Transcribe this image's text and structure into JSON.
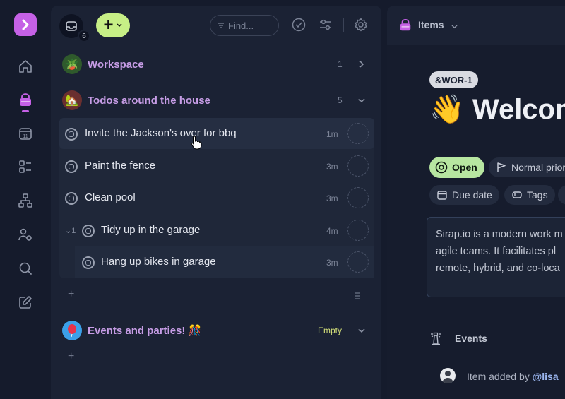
{
  "app": {
    "logo_icon": "chevron-right-icon",
    "accent": "#c561e6"
  },
  "rail": {
    "items": [
      {
        "name": "home",
        "icon": "home-icon"
      },
      {
        "name": "items",
        "icon": "basket-icon",
        "active": true
      },
      {
        "name": "calendar",
        "icon": "calendar-icon",
        "badge": "11"
      },
      {
        "name": "boards",
        "icon": "board-icon"
      },
      {
        "name": "hierarchy",
        "icon": "hierarchy-icon"
      },
      {
        "name": "team-settings",
        "icon": "users-gear-icon"
      },
      {
        "name": "search",
        "icon": "search-icon"
      },
      {
        "name": "compose",
        "icon": "compose-icon"
      }
    ]
  },
  "toolbar": {
    "inbox_count": "6",
    "add_symbol": "+",
    "search_placeholder": "Find...",
    "icons": [
      "check-circle-icon",
      "filter-sliders-icon",
      "gear-icon"
    ]
  },
  "groups": [
    {
      "title": "Workspace",
      "count": "1",
      "avatar": "🪴",
      "expanded": false
    },
    {
      "title": "Todos around the house",
      "count": "5",
      "avatar": "🏡",
      "expanded": true
    },
    {
      "title": "Events and parties! 🎊",
      "status": "Empty",
      "avatar": "🎈",
      "expanded": true
    }
  ],
  "tasks": [
    {
      "title": "Invite the Jackson's over for bbq",
      "time": "1m"
    },
    {
      "title": "Paint the fence",
      "time": "3m"
    },
    {
      "title": "Clean pool",
      "time": "3m"
    },
    {
      "title": "Tidy up in the garage",
      "time": "4m",
      "subtask_count": "1"
    },
    {
      "title": "Hang up bikes in garage",
      "time": "3m"
    }
  ],
  "add_symbol": "+",
  "detail": {
    "header": "Items",
    "ref": "&WOR-1",
    "title": "👋 Welcom",
    "status": "Open",
    "priority": "Normal prior",
    "due_date": "Due date",
    "tags": "Tags",
    "description_lines": [
      "Sirap.io is a modern work m",
      "agile teams. It facilitates pl",
      "remote, hybrid, and co-loca"
    ],
    "events_label": "Events",
    "event": {
      "prefix": "Item added by ",
      "user": "@lisa"
    }
  }
}
